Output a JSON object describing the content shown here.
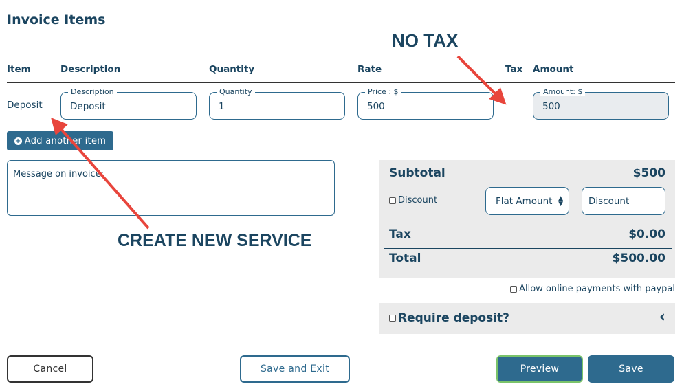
{
  "title": "Invoice Items",
  "columns": [
    "Item",
    "Description",
    "Quantity",
    "Rate",
    "Tax",
    "Amount"
  ],
  "row": {
    "item": "Deposit",
    "description": {
      "label": "Description",
      "value": "Deposit"
    },
    "quantity": {
      "label": "Quantity",
      "value": "1"
    },
    "rate": {
      "label": "Price : $",
      "value": "500"
    },
    "amount": {
      "label": "Amount: $",
      "value": "500"
    }
  },
  "add_item": "Add another item",
  "message_placeholder": "Message on invoice:",
  "summary": {
    "subtotal_label": "Subtotal",
    "subtotal": "$500",
    "discount_label": "Discount",
    "discount_type": "Flat Amount",
    "discount_placeholder": "Discount",
    "tax_label": "Tax",
    "tax": "$0.00",
    "total_label": "Total",
    "total": "$500.00"
  },
  "paypal_label": "Allow online payments with paypal",
  "deposit_label": "Require deposit?",
  "buttons": {
    "cancel": "Cancel",
    "save_exit": "Save and Exit",
    "preview": "Preview",
    "save": "Save"
  },
  "annotations": {
    "no_tax": "NO TAX",
    "create_service": "CREATE NEW SERVICE"
  },
  "colors": {
    "primary": "#2e6a8e",
    "text": "#1b4560",
    "arrow": "#e8453c",
    "preview_border": "#7ac36a"
  }
}
